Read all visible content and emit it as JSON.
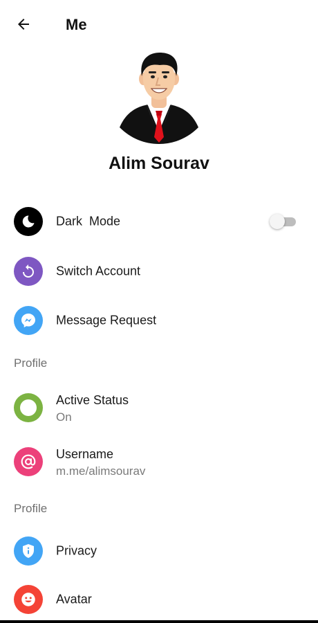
{
  "appbar": {
    "title": "Me",
    "back_icon": "arrow-left-icon"
  },
  "profile": {
    "name": "Alim Sourav"
  },
  "rows_top": [
    {
      "label": "Dark  Mode",
      "icon": "moon-icon",
      "color": "#000000",
      "has_toggle": true,
      "toggle_on": false
    },
    {
      "label": "Switch Account",
      "icon": "switch-account-icon",
      "color": "#7E57C2"
    },
    {
      "label": "Message Request",
      "icon": "messenger-icon",
      "color": "#42A5F5"
    }
  ],
  "section1": {
    "title": "Profile"
  },
  "rows_mid": [
    {
      "label": "Active Status",
      "sublabel": "On",
      "icon": "active-status-icon",
      "color": "#7CB342"
    },
    {
      "label": "Username",
      "sublabel": "m.me/alimsourav",
      "icon": "at-sign-icon",
      "color": "#EC407A"
    }
  ],
  "section2": {
    "title": "Profile"
  },
  "rows_bottom": [
    {
      "label": "Privacy",
      "icon": "shield-icon",
      "color": "#42A5F5"
    },
    {
      "label": "Avatar",
      "icon": "smiley-icon",
      "color": "#F44336"
    }
  ]
}
